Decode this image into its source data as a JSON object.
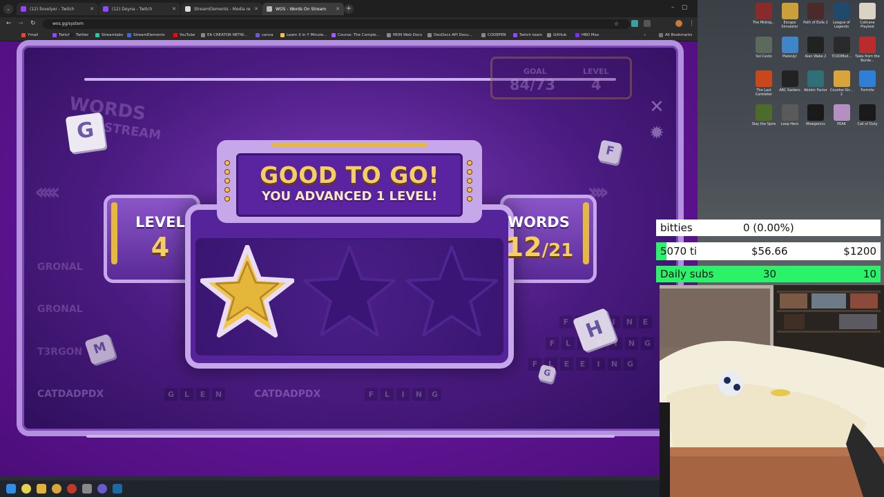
{
  "browser": {
    "tabs": [
      {
        "label": "(12) llovelyer - Twitch",
        "active": false
      },
      {
        "label": "(12) Deyna - Twitch",
        "active": false
      },
      {
        "label": "StreamElements - Media re",
        "active": false
      },
      {
        "label": "WOS - Words On Stream",
        "active": true
      }
    ],
    "url": "wos.gg/system",
    "bookmarks": [
      "Ymail",
      "Twitch",
      "Twitter",
      "Streamlabs",
      "StreamElements",
      "YouTube",
      "EA CREATOR NETW...",
      "canva",
      "Learn X in Y Minute...",
      "Course: The Comple...",
      "MDN Web Docs",
      "DevDocs API Docu...",
      "CODEPEN",
      "Twitch team",
      "GitHub",
      "HBO Max"
    ],
    "all_bookmarks": "All Bookmarks"
  },
  "game": {
    "logo_line1": "WORDS",
    "logo_line2": "STREAM",
    "goal_label": "GOAL",
    "goal_value": "84/73",
    "level_label": "LEVEL",
    "level_value": "4",
    "background_words": [
      "GRONAL",
      "GRONAL",
      "T3RGON",
      "CATDADPDX",
      "CATDADPDX"
    ],
    "background_letters_a": [
      "G",
      "L",
      "E",
      "N"
    ],
    "background_letters_b": [
      "F",
      "L",
      "I",
      "N",
      "G"
    ],
    "background_letters_c": [
      "F",
      "L",
      "E",
      "E",
      "I",
      "N",
      "G"
    ],
    "background_letters_d": [
      "F",
      "L",
      "E",
      "E",
      "I",
      "N",
      "G"
    ],
    "background_letters_e": [
      "F",
      "L",
      "E",
      "I",
      "N",
      "E"
    ],
    "dice_letters": [
      "G",
      "F",
      "M",
      "H",
      "G"
    ]
  },
  "modal": {
    "headline": "GOOD TO GO!",
    "subline": "YOU ADVANCED 1 LEVEL!",
    "level_label": "LEVEL",
    "level_value": "4",
    "words_label": "WORDS",
    "words_found": "12",
    "words_total": "/21",
    "stars_earned": 1,
    "stars_total": 3
  },
  "overlay": {
    "bits_name": "bitties",
    "bits_value": "0 (0.00%)",
    "goal_name": "5070 ti",
    "goal_current": "$56.66",
    "goal_target": "$1200",
    "goal_fraction": 0.047,
    "subs_label": "Daily subs",
    "subs_current": "30",
    "subs_target": "10"
  },
  "desktop_icons": [
    {
      "label": "The Midnig...",
      "color": "#8b2a2a"
    },
    {
      "label": "Escape Simulator",
      "color": "#c9a03a"
    },
    {
      "label": "Path of Exile 2",
      "color": "#4a2a2a"
    },
    {
      "label": "League of Legends",
      "color": "#1f4a6b"
    },
    {
      "label": "Coltrane Playtest",
      "color": "#d9d2c5"
    },
    {
      "label": "Sol Cesto",
      "color": "#5b6a5a"
    },
    {
      "label": "PlateUp!",
      "color": "#3f86c9"
    },
    {
      "label": "Alan Wake 2",
      "color": "#222222"
    },
    {
      "label": "7D2DMod...",
      "color": "#2a2a2a"
    },
    {
      "label": "Tales from the Borde...",
      "color": "#b82c2c"
    },
    {
      "label": "The Last Caretaker",
      "color": "#c8481b"
    },
    {
      "label": "ARC Raiders",
      "color": "#222222"
    },
    {
      "label": "Abiotic Factor",
      "color": "#2f6f78"
    },
    {
      "label": "Counter-Str... 2",
      "color": "#d8a53a"
    },
    {
      "label": "Fortnite",
      "color": "#2f7fd6"
    },
    {
      "label": "Slay the Spire",
      "color": "#4d6b2a"
    },
    {
      "label": "Loop Hero",
      "color": "#5a5a5a"
    },
    {
      "label": "Mewgenics",
      "color": "#1a1a1a"
    },
    {
      "label": "PEAK",
      "color": "#b48fc2"
    },
    {
      "label": "Call of Duty",
      "color": "#1a1a1a"
    }
  ]
}
